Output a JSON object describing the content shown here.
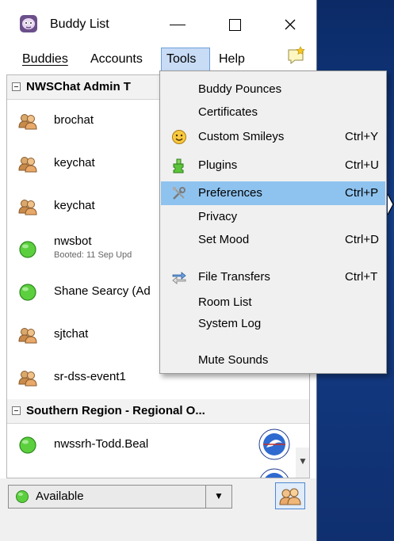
{
  "window": {
    "title": "Buddy List",
    "controls": {
      "minimize": "—",
      "maximize": "☐",
      "close": "✕"
    }
  },
  "menubar": {
    "items": [
      {
        "label": "Buddies"
      },
      {
        "label": "Accounts"
      },
      {
        "label": "Tools"
      },
      {
        "label": "Help"
      }
    ]
  },
  "buddy_list": {
    "groups": [
      {
        "name": "NWSChat Admin T",
        "buddies": [
          {
            "name": "brochat",
            "icon": "chat-room-icon"
          },
          {
            "name": "keychat",
            "icon": "chat-room-icon"
          },
          {
            "name": "keychat",
            "icon": "chat-room-icon"
          },
          {
            "name": "nwsbot",
            "status": "Booted: 11 Sep Upd",
            "icon": "available-icon"
          },
          {
            "name": "Shane Searcy (Ad",
            "icon": "available-icon"
          },
          {
            "name": "sjtchat",
            "icon": "chat-room-icon"
          },
          {
            "name": "sr-dss-event1",
            "icon": "chat-room-icon"
          }
        ]
      },
      {
        "name": "Southern Region - Regional O...",
        "buddies": [
          {
            "name": "nwssrh-Todd.Beal",
            "icon": "available-icon"
          }
        ]
      }
    ]
  },
  "status_selector": {
    "value": "Available",
    "dropdown_glyph": "▼"
  },
  "tools_menu": {
    "items": [
      {
        "label": "Buddy Pounces",
        "shortcut": ""
      },
      {
        "label": "Certificates",
        "shortcut": ""
      },
      {
        "label": "Custom Smileys",
        "shortcut": "Ctrl+Y",
        "icon": "smiley-icon"
      },
      {
        "label": "Plugins",
        "shortcut": "Ctrl+U",
        "icon": "puzzle-icon"
      },
      {
        "label": "Preferences",
        "shortcut": "Ctrl+P",
        "icon": "tools-icon",
        "highlighted": true
      },
      {
        "label": "Privacy",
        "shortcut": ""
      },
      {
        "label": "Set Mood",
        "shortcut": "Ctrl+D"
      },
      {
        "label": "File Transfers",
        "shortcut": "Ctrl+T",
        "icon": "transfer-icon"
      },
      {
        "label": "Room List",
        "shortcut": ""
      },
      {
        "label": "System Log",
        "shortcut": ""
      },
      {
        "label": "Mute Sounds",
        "shortcut": ""
      }
    ]
  },
  "colors": {
    "menu_highlight": "#8fc3ef",
    "menubar_active": "#c8dcf6",
    "available_green": "#4fc83a",
    "desktop_blue": "#163a78"
  }
}
